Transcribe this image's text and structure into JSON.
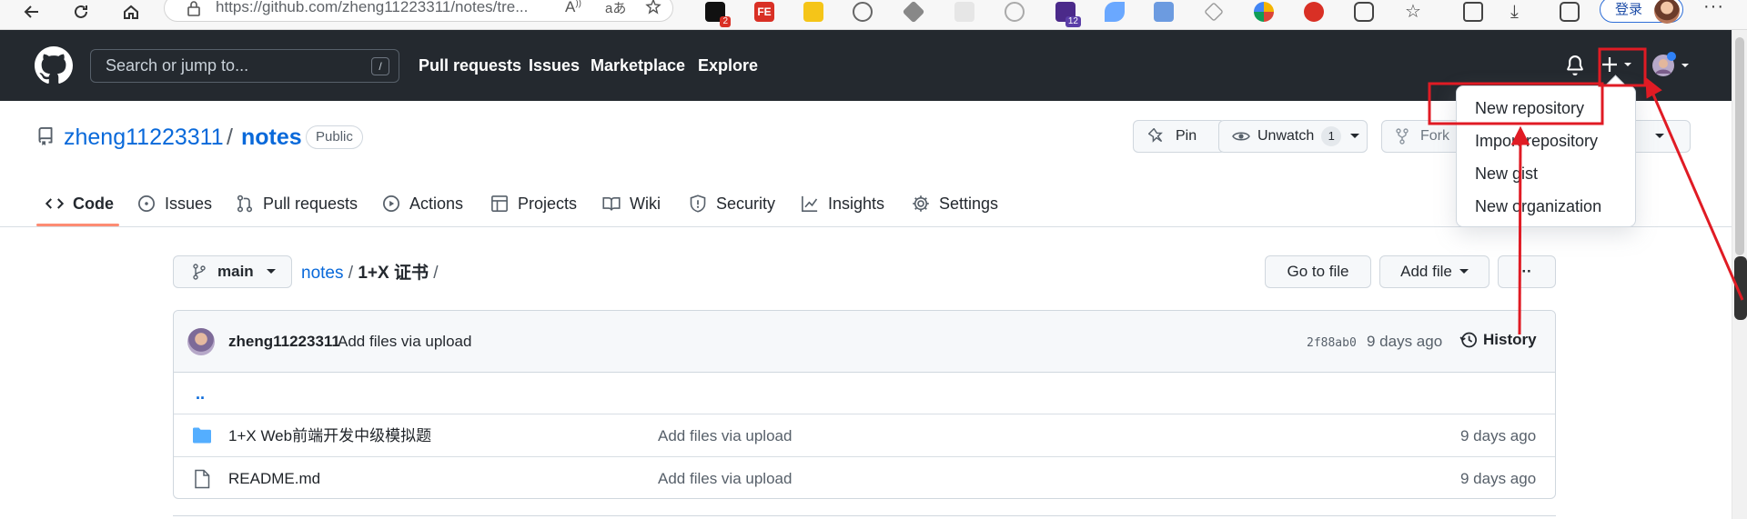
{
  "browser": {
    "url": "https://github.com/zheng11223311/notes/tre...",
    "login_label": "登录",
    "ext_badge_1": "2",
    "ext_badge_2": "12",
    "ext_fe_label": "FE"
  },
  "gh_header": {
    "search_placeholder": "Search or jump to...",
    "search_shortcut": "/",
    "nav": [
      "Pull requests",
      "Issues",
      "Marketplace",
      "Explore"
    ]
  },
  "repo": {
    "owner": "zheng11223311",
    "separator": "/",
    "name": "notes",
    "visibility": "Public",
    "pin_label": "Pin",
    "unwatch_label": "Unwatch",
    "watch_count": "1",
    "fork_label": "Fork"
  },
  "tabs": [
    {
      "label": "Code",
      "icon": "code-icon"
    },
    {
      "label": "Issues",
      "icon": "issue-icon"
    },
    {
      "label": "Pull requests",
      "icon": "pull-request-icon"
    },
    {
      "label": "Actions",
      "icon": "play-icon"
    },
    {
      "label": "Projects",
      "icon": "table-icon"
    },
    {
      "label": "Wiki",
      "icon": "book-icon"
    },
    {
      "label": "Security",
      "icon": "shield-icon"
    },
    {
      "label": "Insights",
      "icon": "graph-icon"
    },
    {
      "label": "Settings",
      "icon": "gear-icon"
    }
  ],
  "file_nav": {
    "branch": "main",
    "crumb_repo": "notes",
    "crumb_sep": "/",
    "crumb_folder": "1+X 证书",
    "crumb_trailing": "/",
    "goto_file": "Go to file",
    "add_file": "Add file",
    "more": "··"
  },
  "commit": {
    "author": "zheng11223311",
    "message": "Add files via upload",
    "sha": "2f88ab0",
    "age": "9 days ago",
    "history": "History"
  },
  "files": {
    "parent": "..",
    "rows": [
      {
        "name": "1+X Web前端开发中级模拟题",
        "type": "folder",
        "message": "Add files via upload",
        "age": "9 days ago"
      },
      {
        "name": "README.md",
        "type": "file",
        "message": "Add files via upload",
        "age": "9 days ago"
      }
    ]
  },
  "plus_menu": [
    "New repository",
    "Import repository",
    "New gist",
    "New organization"
  ],
  "colors": {
    "header_bg": "#24292f",
    "link": "#0969da",
    "tab_underline": "#fd8c73",
    "annotation": "#e01b24",
    "folder": "#54aeff"
  }
}
